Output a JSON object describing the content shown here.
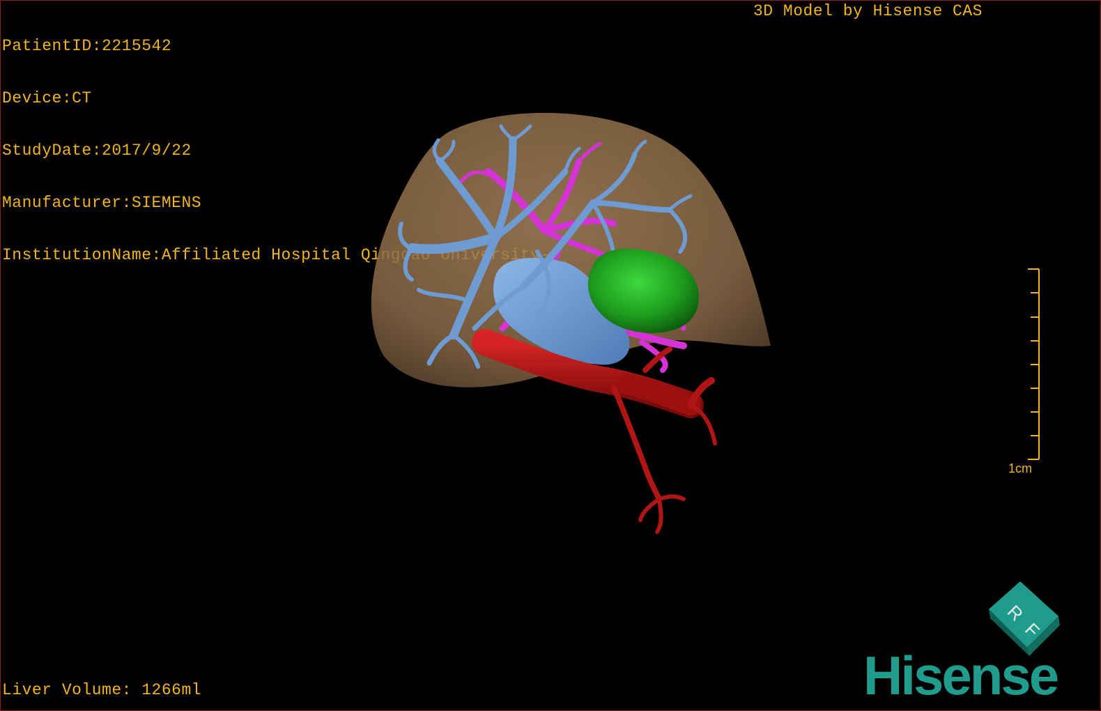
{
  "patient": {
    "patient_id": "PatientID:2215542",
    "device": "Device:CT",
    "study_date": "StudyDate:2017/9/22",
    "manufacturer": "Manufacturer:SIEMENS",
    "institution": "InstitutionName:Affiliated Hospital Qingdao University-C"
  },
  "header": {
    "model_title": "3D Model by Hisense CAS"
  },
  "footer": {
    "liver_volume": "Liver Volume: 1266ml"
  },
  "scale": {
    "label": "1cm"
  },
  "orientation_cube": {
    "face_letters": [
      "R",
      "F"
    ]
  },
  "brand": {
    "name": "Hisense",
    "color": "#1f9c8c"
  },
  "colors": {
    "text": "#f0b41e",
    "liver": "#8b6a48",
    "portal_vein": "#6e9bd2",
    "hepatic_vein": "#d633d6",
    "artery": "#b01515",
    "tumor": "#1e9e1e",
    "cube": "#1f9c8c"
  },
  "icons": [
    "orientation-cube-icon",
    "scale-bar-icon",
    "brand-logo"
  ]
}
